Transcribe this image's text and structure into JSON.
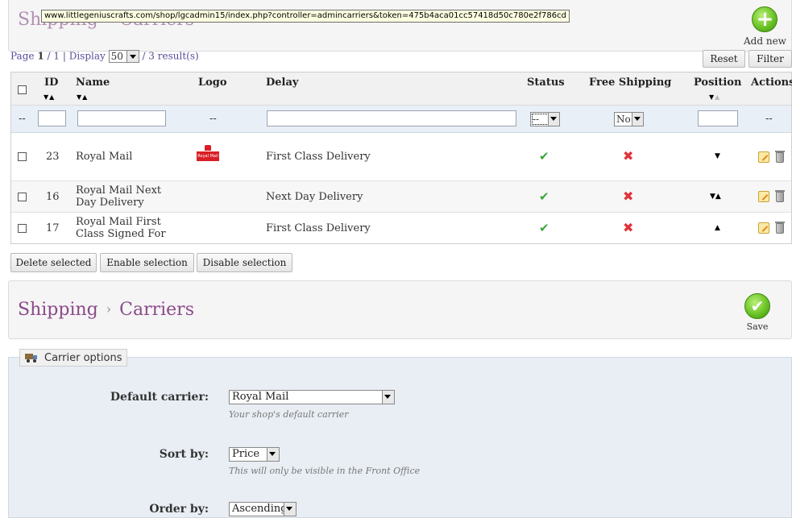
{
  "url_tooltip": "www.littlegeniuscrafts.com/shop/lgcadmin15/index.php?controller=admincarriers&token=475b4aca01cc57418d50c780e2f786cd",
  "top_toolbar": {
    "breadcrumb_1": "Shipping",
    "separator": "›",
    "breadcrumb_2": "Carriers",
    "add_new_label": "Add new",
    "add_icon_glyph": "+"
  },
  "pagination": {
    "page_prefix": "Page",
    "current_page": "1",
    "slash": "/",
    "total_pages": "1",
    "pipe": "|",
    "display_label": "Display",
    "per_page": "50",
    "results": "/ 3 result(s)"
  },
  "list_buttons": {
    "reset": "Reset",
    "filter": "Filter"
  },
  "table": {
    "headers": {
      "id": "ID",
      "name": "Name",
      "logo": "Logo",
      "delay": "Delay",
      "status": "Status",
      "free_shipping": "Free Shipping",
      "position": "Position",
      "actions": "Actions"
    },
    "sort_glyphs": {
      "down": "▼",
      "up": "▲"
    },
    "filter": {
      "dash": "--",
      "status_value": "--",
      "free_shipping_value": "No"
    },
    "rows": [
      {
        "id": "23",
        "name_line1": "Royal Mail",
        "name_line2": "",
        "delay": "First Class Delivery",
        "logo_text": "Royal Mail",
        "position_arrows": "▼"
      },
      {
        "id": "16",
        "name_line1": "Royal Mail Next",
        "name_line2": "Day Delivery",
        "delay": "Next Day Delivery",
        "logo_text": "",
        "position_arrows": "▼▲"
      },
      {
        "id": "17",
        "name_line1": "Royal Mail First",
        "name_line2": "Class Signed For",
        "delay": "First Class Delivery",
        "logo_text": "",
        "position_arrows": "▲"
      }
    ],
    "status_glyph": "✔",
    "free_shipping_glyph": "✖"
  },
  "bulk_actions": {
    "delete": "Delete selected",
    "enable": "Enable selection",
    "disable": "Disable selection"
  },
  "bottom_toolbar": {
    "breadcrumb_1": "Shipping",
    "separator": "›",
    "breadcrumb_2": "Carriers",
    "save_label": "Save",
    "save_icon_glyph": "✔"
  },
  "carrier_options": {
    "legend": "Carrier options",
    "default_carrier_label": "Default carrier:",
    "default_carrier_value": "Royal Mail",
    "default_carrier_hint": "Your shop's default carrier",
    "sort_by_label": "Sort by:",
    "sort_by_value": "Price",
    "sort_by_hint": "This will only be visible in the Front Office",
    "order_by_label": "Order by:",
    "order_by_value": "Ascending"
  },
  "colors": {
    "title_purple": "#8a4a8a",
    "status_green": "#3ea53e",
    "disabled_red": "#e0333b",
    "panel_blue": "#e9eef4"
  },
  "icons": [
    "add-icon",
    "save-icon",
    "check-icon",
    "cross-icon",
    "edit-icon",
    "delete-icon",
    "truck-icon",
    "royal-mail-logo"
  ]
}
